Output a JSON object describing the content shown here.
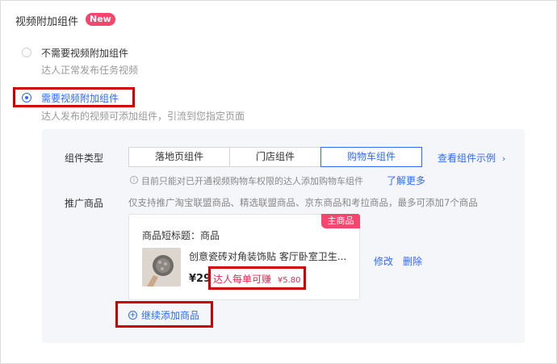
{
  "section": {
    "title": "视频附加组件",
    "badge": "New"
  },
  "options": [
    {
      "label": "不需要视频附加组件",
      "desc": "达人正常发布任务视频",
      "selected": false
    },
    {
      "label": "需要视频附加组件",
      "desc": "达人发布的视频可添加组件，引流到您指定页面",
      "selected": true
    }
  ],
  "component": {
    "type_label": "组件类型",
    "tabs": [
      "落地页组件",
      "门店组件",
      "购物车组件"
    ],
    "active_tab": 2,
    "example_link": "查看组件示例",
    "hint": "目前只能对已开通视频购物车权限的达人添加购物车组件",
    "learn_more": "了解更多"
  },
  "promo": {
    "label": "推广商品",
    "desc": "仅支持推广淘宝联盟商品、精选联盟商品、京东商品和考拉商品，最多可添加7个商品",
    "card": {
      "tag": "主商品",
      "short_title": "商品短标题：商品",
      "name": "创意瓷砖对角装饰贴 客厅卧室卫生...",
      "price": "¥29",
      "earn_label": "达人每单可赚",
      "earn_value": "¥5.80",
      "edit": "修改",
      "delete": "删除"
    },
    "add_more": "继续添加商品"
  },
  "icons": {
    "radio_unchecked": "radio-unchecked-icon",
    "radio_checked": "radio-checked-icon",
    "info": "info-icon",
    "chevron": "chevron-right-icon",
    "add": "plus-circle-icon"
  },
  "colors": {
    "accent": "#2f6bff",
    "badge": "#f5466e",
    "highlight": "#d40000",
    "earn": "#e8294f"
  }
}
